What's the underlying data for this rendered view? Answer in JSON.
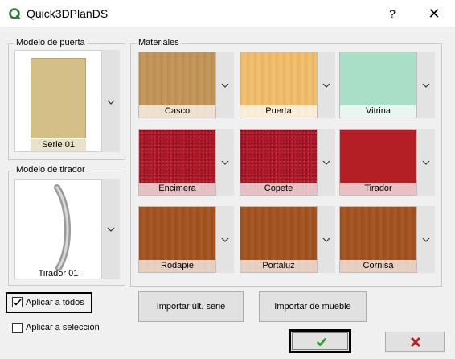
{
  "window": {
    "title": "Quick3DPlanDS",
    "help_label": "?",
    "close_label": "✕",
    "logo_icon": "q-logo-icon"
  },
  "door_model": {
    "label": "Modelo de puerta",
    "item_label": "Serie 01",
    "swatch_color": "#d4bf86"
  },
  "handle_model": {
    "label": "Modelo de tirador",
    "item_label": "Tirador 01"
  },
  "materials": {
    "label": "Materiales",
    "tiles": [
      {
        "label": "Casco",
        "color": "#c39457",
        "texture": "wood"
      },
      {
        "label": "Puerta",
        "color": "#f2bd6a",
        "texture": "wood"
      },
      {
        "label": "Vitrina",
        "color": "#a9dfc6",
        "texture": "flat"
      },
      {
        "label": "Encimera",
        "color": "#b3192a",
        "texture": "granite"
      },
      {
        "label": "Copete",
        "color": "#b3192a",
        "texture": "granite"
      },
      {
        "label": "Tirador",
        "color": "#b31f25",
        "texture": "flat"
      },
      {
        "label": "Rodapie",
        "color": "#a3531e",
        "texture": "wood"
      },
      {
        "label": "Portaluz",
        "color": "#a3531e",
        "texture": "wood"
      },
      {
        "label": "Cornisa",
        "color": "#a3531e",
        "texture": "wood"
      }
    ]
  },
  "options": {
    "apply_all_label": "Aplicar a todos",
    "apply_all_checked": true,
    "apply_selection_label": "Aplicar a selección",
    "apply_selection_checked": false
  },
  "buttons": {
    "import_last_series": "Importar últ. serie",
    "import_furniture": "Importar de mueble",
    "ok_icon": "checkmark-icon",
    "ok_color": "#2a9d2a",
    "cancel_icon": "x-icon",
    "cancel_color": "#b22222"
  }
}
